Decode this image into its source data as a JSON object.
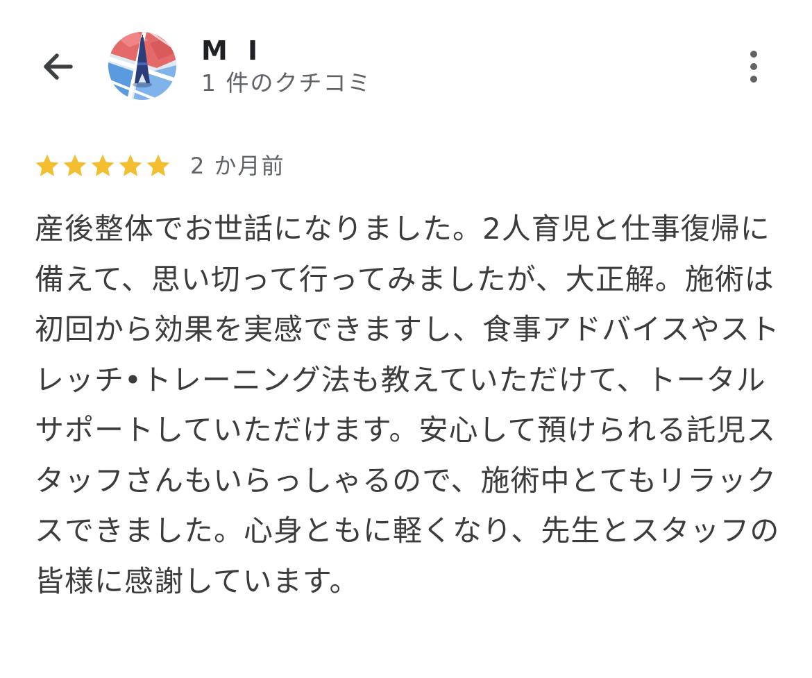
{
  "header": {
    "back_icon": "arrow-left-icon",
    "avatar_icon": "map-avatar-icon",
    "user_name": "M I",
    "review_count": "1 件のクチコミ",
    "more_icon": "more-vertical-icon"
  },
  "review": {
    "rating": 5,
    "rating_max": 5,
    "star_color": "#F4BE32",
    "date": "2 か月前",
    "text": "産後整体でお世話になりました。2人育児と仕事復帰に備えて、思い切って行ってみましたが、大正解。施術は初回から効果を実感できますし、食事アドバイスやストレッチ•トレーニング法も教えていただけて、トータルサポートしていただけます。安心して預けられる託児スタッフさんもいらっしゃるので、施術中とてもリラックスできました。心身ともに軽くなり、先生とスタッフの皆様に感謝しています。"
  }
}
